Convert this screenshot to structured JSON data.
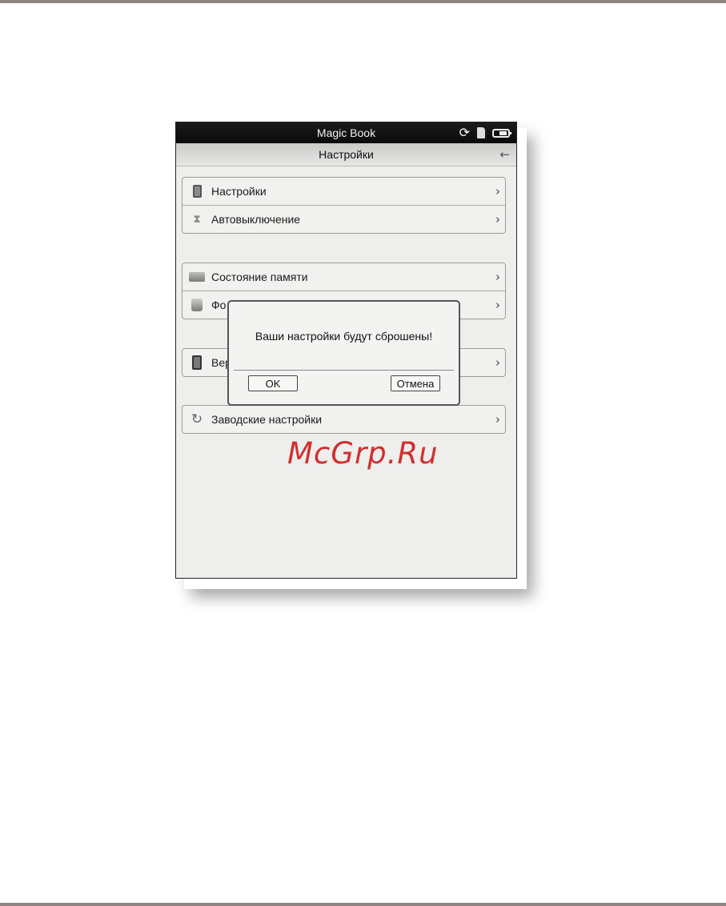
{
  "status_bar": {
    "title": "Magic Book",
    "icons": [
      "sync-icon",
      "sd-card-icon",
      "battery-icon"
    ]
  },
  "title_bar": {
    "title": "Настройки",
    "back_icon": "back-arrow-icon"
  },
  "groups": [
    {
      "items": [
        {
          "label": "Настройки",
          "icon": "device-settings-icon"
        },
        {
          "label": "Автовыключение",
          "icon": "hourglass-icon"
        }
      ]
    },
    {
      "items": [
        {
          "label": "Состояние памяти",
          "icon": "drive-icon"
        },
        {
          "label": "Фо",
          "icon": "format-icon"
        }
      ]
    },
    {
      "items": [
        {
          "label": "Вер",
          "icon": "phone-icon"
        }
      ]
    },
    {
      "items": [
        {
          "label": "Заводские настройки",
          "icon": "refresh-icon"
        }
      ]
    }
  ],
  "dialog": {
    "message": "Ваши настройки будут сброшены!",
    "ok_label": "OK",
    "cancel_label": "Отмена"
  },
  "watermark": "McGrp.Ru",
  "colors": {
    "watermark": "#d0302f",
    "status_bar": "#111111",
    "screen_bg": "#eeeeec"
  }
}
